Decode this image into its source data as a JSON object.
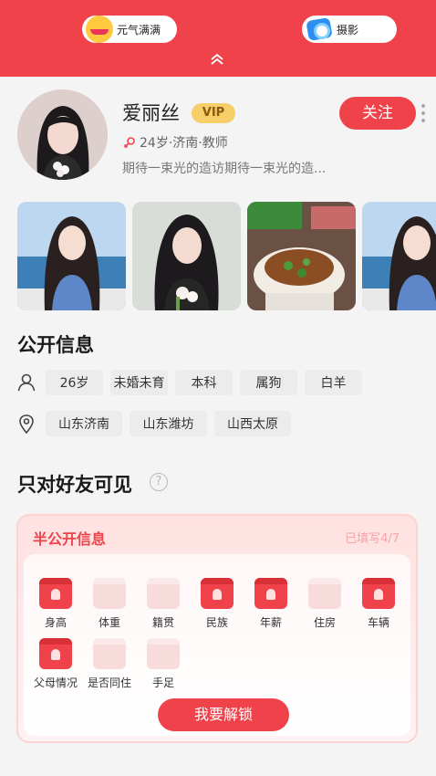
{
  "top_bar": {
    "left_pill": {
      "label": "元气满满",
      "icon": "smile-emoji-icon"
    },
    "right_pill": {
      "label": "摄影",
      "icon": "camera-emoji-icon"
    },
    "collapse_icon": "chevron-up-icon"
  },
  "profile": {
    "name": "爱丽丝",
    "vip_badge": "VIP",
    "meta": "24岁·济南·教师",
    "bio": "期待一束光的造访期待一束光的造...",
    "follow_label": "关注"
  },
  "photos": [
    "photo-1",
    "photo-2",
    "photo-3",
    "photo-4"
  ],
  "public_info": {
    "title": "公开信息",
    "basic_tags": [
      "26岁",
      "未婚未育",
      "本科",
      "属狗",
      "白羊"
    ],
    "location_tags": [
      "山东济南",
      "山东潍坊",
      "山西太原"
    ]
  },
  "friends_only": {
    "title": "只对好友可见",
    "help_icon": "?"
  },
  "semi_public": {
    "title": "半公开信息",
    "count": "已填写4/7",
    "items": [
      {
        "label": "身高",
        "locked": true
      },
      {
        "label": "体重",
        "locked": false
      },
      {
        "label": "籍贯",
        "locked": false
      },
      {
        "label": "民族",
        "locked": true
      },
      {
        "label": "年薪",
        "locked": true
      },
      {
        "label": "住房",
        "locked": false
      },
      {
        "label": "车辆",
        "locked": true
      },
      {
        "label": "父母情况",
        "locked": true
      },
      {
        "label": "是否同住",
        "locked": false
      },
      {
        "label": "手足",
        "locked": false
      }
    ],
    "unlock_label": "我要解锁"
  },
  "colors": {
    "accent": "#f0424a",
    "vip": "#f6ce6a"
  }
}
